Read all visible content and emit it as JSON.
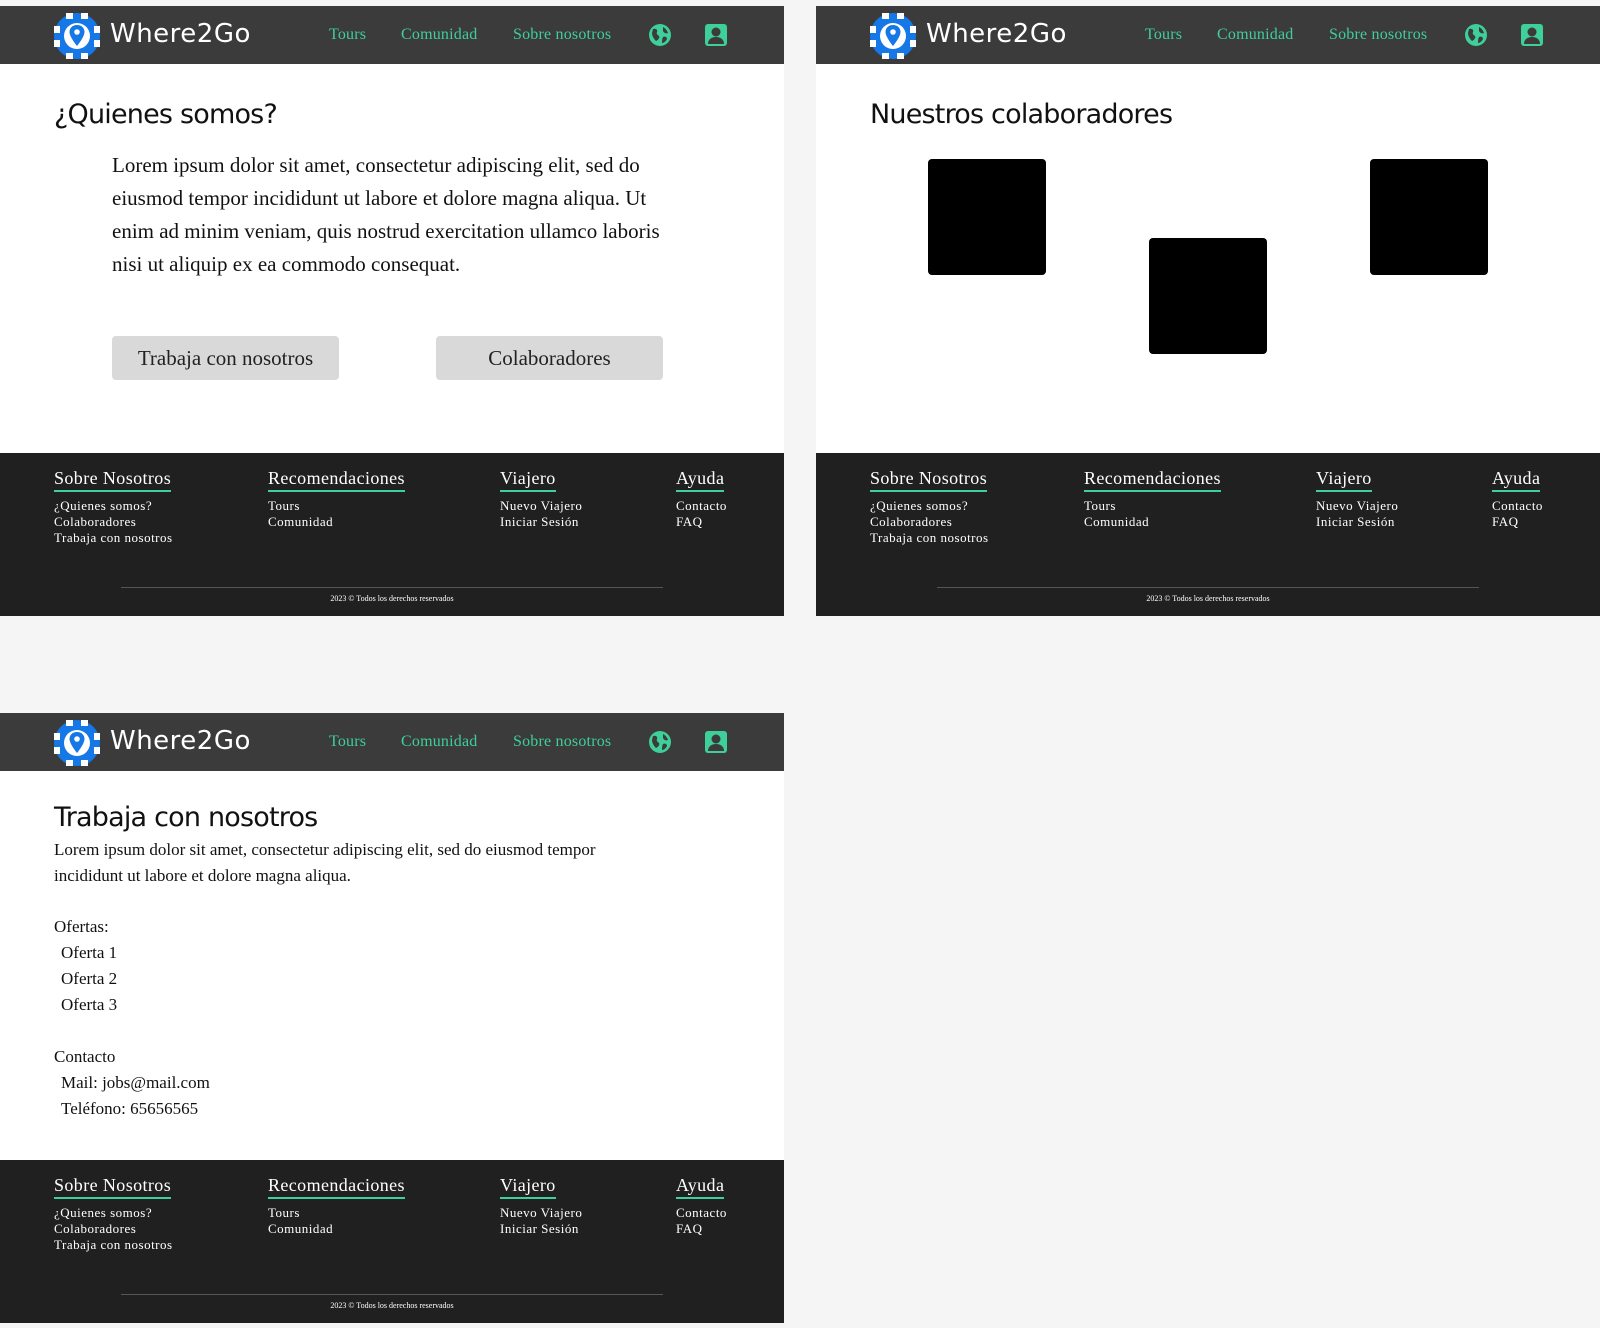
{
  "brand": {
    "name": "Where2Go"
  },
  "nav": {
    "links": [
      "Tours",
      "Comunidad",
      "Sobre nosotros"
    ],
    "icons": [
      "globe-icon",
      "user-icon"
    ]
  },
  "colors": {
    "navbar": "#3b3b3b",
    "accent": "#3ecf9a",
    "logo_blue": "#1677e6",
    "footer": "#202020",
    "button": "#d9d9d9"
  },
  "about": {
    "title": "¿Quienes somos?",
    "text": "Lorem ipsum dolor sit amet, consectetur adipiscing elit, sed do eiusmod tempor incididunt ut labore et dolore magna aliqua. Ut enim ad minim veniam, quis nostrud exercitation ullamco laboris nisi ut aliquip ex ea commodo consequat.",
    "buttons": [
      "Trabaja con nosotros",
      "Colaboradores"
    ]
  },
  "collaborators": {
    "title": "Nuestros colaboradores"
  },
  "jobs": {
    "title": "Trabaja con nosotros",
    "text": "Lorem ipsum dolor sit amet, consectetur adipiscing elit, sed do eiusmod tempor incididunt ut labore et dolore magna aliqua.",
    "offers_label": "Ofertas:",
    "offers": [
      "Oferta 1",
      "Oferta 2",
      "Oferta 3"
    ],
    "contact_label": "Contacto",
    "mail": "Mail: jobs@mail.com",
    "phone": "Teléfono: 65656565"
  },
  "footer": {
    "columns": [
      {
        "title": "Sobre Nosotros",
        "links": [
          "¿Quienes somos?",
          "Colaboradores",
          "Trabaja con nosotros"
        ]
      },
      {
        "title": "Recomendaciones",
        "links": [
          "Tours",
          "Comunidad"
        ]
      },
      {
        "title": "Viajero",
        "links": [
          "Nuevo Viajero",
          "Iniciar Sesión"
        ]
      },
      {
        "title": "Ayuda",
        "links": [
          "Contacto",
          "FAQ"
        ]
      }
    ],
    "copyright": "2023 © Todos los derechos reservados"
  }
}
